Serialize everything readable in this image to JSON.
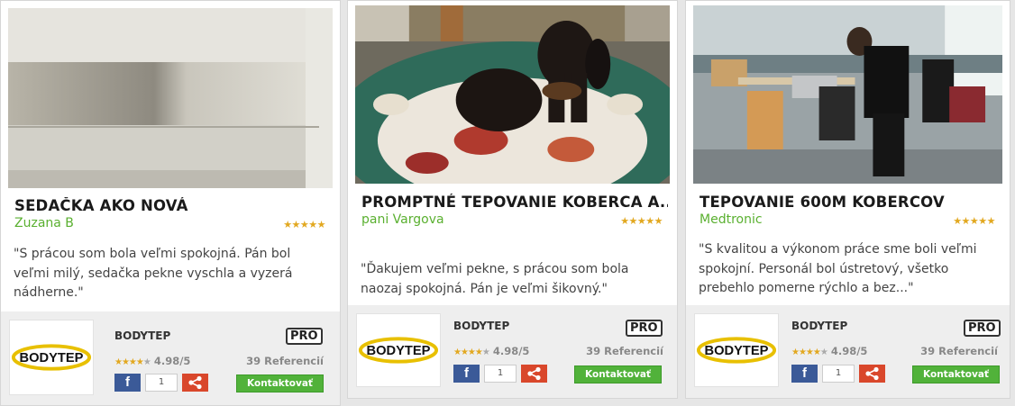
{
  "colors": {
    "accent_green": "#5ab030",
    "button_green": "#51b23a",
    "facebook": "#3b5a98",
    "share": "#d9472b",
    "star": "#e2a820"
  },
  "cards": [
    {
      "photo": "white-sofa-half-cleaned",
      "title": "SEDAČKA AKO NOVÁ",
      "author": "Zuzana B",
      "stars": "★★★★★",
      "rating_stars": 5,
      "quote": "\"S prácou som bola veľmi spokojná. Pán bol veľmi milý, sedačka pekne vyschla a vyzerá nádherne.\"",
      "company": "BODYTEP",
      "badge": "PRO",
      "rating_filled": "★★★★",
      "rating_empty": "★",
      "rating": "4.98/5",
      "refs": "39 Referencií",
      "fb": "f",
      "share_count": "1",
      "contact": "Kontaktovať"
    },
    {
      "photo": "dachshund-on-carpet",
      "title": "PROMPTNÉ TEPOVANIE KOBERCA A...",
      "author": "pani Vargova",
      "stars": "★★★★★",
      "rating_stars": 5,
      "quote": "\"Ďakujem veľmi pekne, s prácou som bola naozaj spokojná. Pán je veľmi šikovný.\"",
      "company": "BODYTEP",
      "badge": "PRO",
      "rating_filled": "★★★★",
      "rating_empty": "★",
      "rating": "4.98/5",
      "refs": "39 Referencií",
      "fb": "f",
      "share_count": "1",
      "contact": "Kontaktovať"
    },
    {
      "photo": "office-carpet-cleaning",
      "title": "TEPOVANIE 600M KOBERCOV",
      "author": "Medtronic",
      "stars": "★★★★★",
      "rating_stars": 4.5,
      "quote": "\"S kvalitou a výkonom práce sme boli veľmi spokojní. Personál bol ústretový, všetko prebehlo pomerne rýchlo a bez...\"",
      "company": "BODYTEP",
      "badge": "PRO",
      "rating_filled": "★★★★",
      "rating_empty": "★",
      "rating": "4.98/5",
      "refs": "39 Referencií",
      "fb": "f",
      "share_count": "1",
      "contact": "Kontaktovať"
    }
  ],
  "logo_text": "BODYTEP"
}
